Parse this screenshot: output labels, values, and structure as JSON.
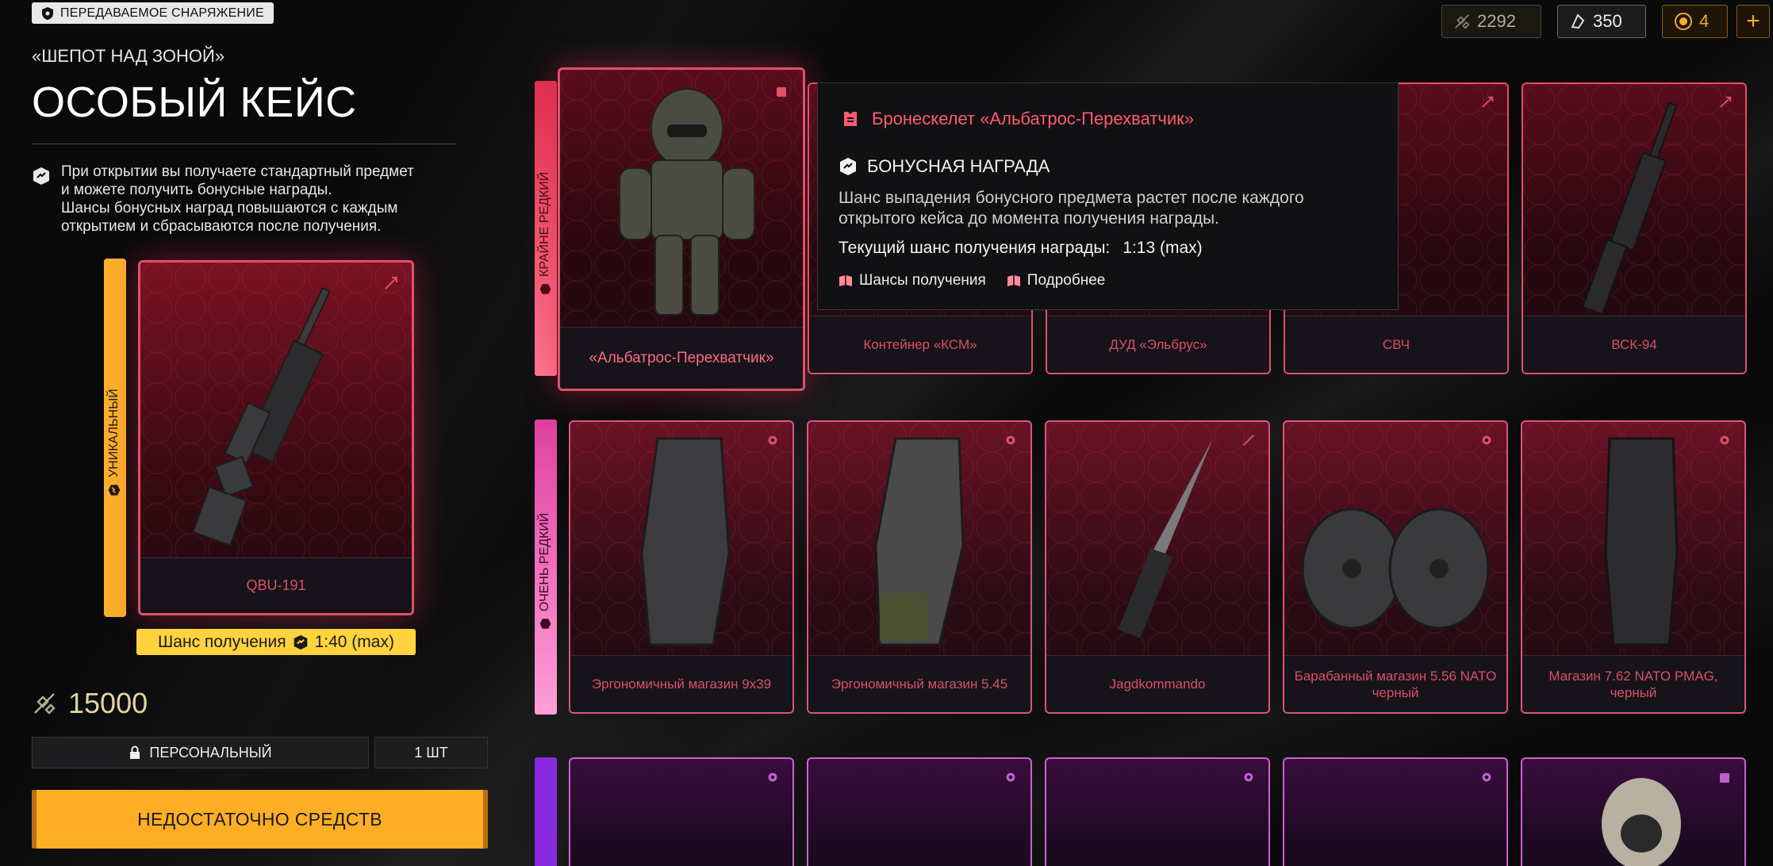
{
  "header": {
    "badge": "ПЕРЕДАВАЕМОЕ СНАРЯЖЕНИЕ",
    "subtitle": "«ШЕПОТ НАД ЗОНОЙ»",
    "title": "ОСОБЫЙ КЕЙС"
  },
  "info": {
    "text": "При открытии вы получаете стандартный предмет\nи можете получить бонусные награды.\nШансы бонусных наград повышаются с каждым\nоткрытием и сбрасываются после получения."
  },
  "featured": {
    "rarity_label": "УНИКАЛЬНЫЙ",
    "item_name": "QBU-191",
    "chance_label": "Шанс получения",
    "chance_value": "1:40 (max)"
  },
  "purchase": {
    "price": "15000",
    "personal_label": "ПЕРСОНАЛЬНЫЙ",
    "quantity": "1 ШТ",
    "action_label": "НЕДОСТАТОЧНО СРЕДСТВ"
  },
  "currencies": {
    "c1": "2292",
    "c2": "350",
    "c3": "4",
    "plus": "+"
  },
  "rarities": {
    "extreme": "КРАЙНЕ РЕДКИЙ",
    "very_rare": "ОЧЕНЬ РЕДКИЙ"
  },
  "row1": {
    "selected": "«Альбатрос-Перехватчик»",
    "items": [
      "Контейнер «КСМ»",
      "ДУД «Эльбрус»",
      "СВЧ",
      "ВСК-94"
    ]
  },
  "row2": {
    "items": [
      "Эргономичный магазин 9х39",
      "Эргономичный магазин 5.45",
      "Jagdkommando",
      "Барабанный магазин 5.56 NATO черный",
      "Магазин 7.62 NATO PMAG, черный"
    ]
  },
  "tooltip": {
    "title": "Бронескелет «Альбатрос-Перехватчик»",
    "bonus_label": "БОНУСНАЯ НАГРАДА",
    "description": "Шанс выпадения бонусного предмета растет после каждого открытого кейса до момента получения награды.",
    "chance_label": "Текущий шанс получения награды:",
    "chance_value": "1:13 (max)",
    "link1": "Шансы получения",
    "link2": "Подробнее"
  },
  "colors": {
    "accent_yellow": "#fdae25",
    "rarity_red": "#e0506a",
    "rarity_pink": "#e040a0",
    "rarity_purple": "#8a2ae0"
  }
}
